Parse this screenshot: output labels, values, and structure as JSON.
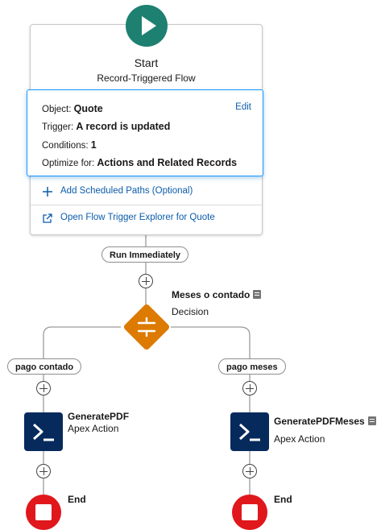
{
  "start": {
    "title": "Start",
    "subtitle": "Record-Triggered Flow",
    "object_label": "Object:",
    "object_value": "Quote",
    "edit_label": "Edit",
    "trigger_label": "Trigger:",
    "trigger_value": "A record is updated",
    "conditions_label": "Conditions:",
    "conditions_value": "1",
    "optimize_label": "Optimize for:",
    "optimize_value": "Actions and Related Records",
    "add_paths_label": "Add Scheduled Paths (Optional)",
    "explorer_label": "Open Flow Trigger Explorer for Quote"
  },
  "path_run": "Run Immediately",
  "decision": {
    "name": "Meses o contado",
    "type": "Decision"
  },
  "branches": [
    {
      "label": "pago contado",
      "action_name": "GeneratePDF",
      "action_type": "Apex Action",
      "end_label": "End"
    },
    {
      "label": "pago meses",
      "action_name": "GeneratePDFMeses",
      "action_type": "Apex Action",
      "end_label": "End"
    }
  ],
  "colors": {
    "start": "#1e8070",
    "decision": "#dd7a01",
    "apex": "#062a5c",
    "end": "#e0171b",
    "link": "#0b5cab",
    "focus": "#1b96ff"
  },
  "icons": {
    "start": "play-icon",
    "add_paths": "plus-icon",
    "explorer": "external-link-icon",
    "decision": "decision-icon",
    "apex": "terminal-icon",
    "end": "stop-icon",
    "description": "description-icon"
  }
}
